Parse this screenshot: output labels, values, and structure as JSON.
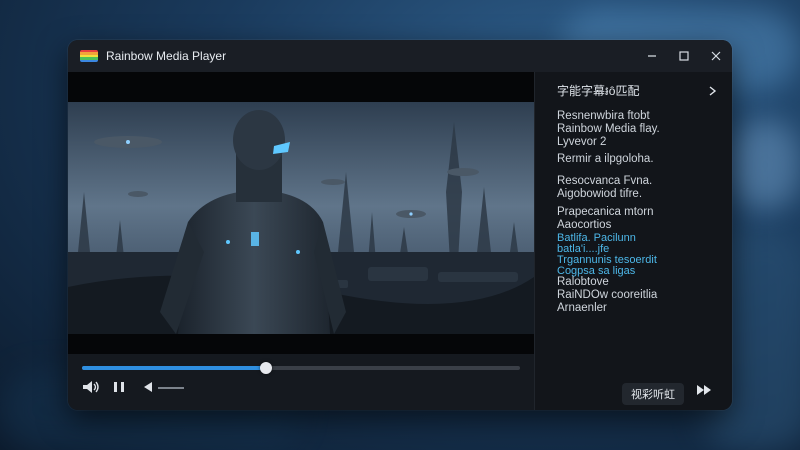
{
  "window": {
    "title": "Rainbow Media Player",
    "logo_colors": [
      "#e94040",
      "#f3a43a",
      "#f4df3c",
      "#4fc05a",
      "#3b86e0"
    ]
  },
  "sidebar": {
    "header": "字能字幕៛ô匹配",
    "blocks": [
      [
        "Resnenwbira ftobt",
        "Rainbow Media flay.",
        "Lyvevor 2"
      ],
      [
        "Rermir a ilpgoloha."
      ],
      [
        "Resocvanca Fvna.",
        "Aigobowiod tifre."
      ],
      [
        "Prapecanica mtorn",
        "Aaocortios"
      ],
      [
        "Batlifa. Pacilunn",
        "batla'i....jfe",
        "Trgannunis tesoerdit",
        "Cogpsa sa ligas"
      ],
      [
        "Ralobtove",
        "RaiNDOw cooreitlia",
        "Arnaenler"
      ]
    ]
  },
  "controls": {
    "progress": 0.42,
    "language_button": "视彩听虹"
  },
  "icons": {
    "volume": "volume-icon",
    "pause": "pause-icon",
    "expand": "chevron-right-icon",
    "next": "fast-forward-icon"
  },
  "colors": {
    "accent": "#2f8fe0",
    "subtitle_highlight": "#4db7e8"
  }
}
